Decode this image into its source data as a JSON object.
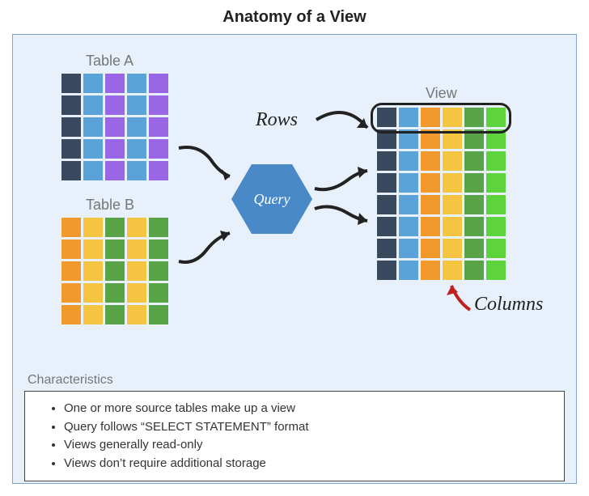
{
  "title": "Anatomy of a View",
  "labels": {
    "table_a": "Table A",
    "table_b": "Table B",
    "view": "View",
    "query": "Query",
    "rows": "Rows",
    "columns": "Columns",
    "characteristics": "Characteristics"
  },
  "characteristics": {
    "items": [
      "One or more source tables make up a view",
      "Query follows “SELECT STATEMENT” format",
      "Views generally read-only",
      "Views don’t require additional storage"
    ]
  },
  "colors": {
    "darkblue": "#3a4a5e",
    "blue": "#5aa3d9",
    "purple": "#9966e6",
    "orange": "#f2992e",
    "yellow": "#f5c542",
    "green": "#57a346",
    "brightgreen": "#5ed43c"
  },
  "tables": {
    "a": {
      "rows": 5,
      "cols": 5,
      "pattern": [
        "darkblue",
        "blue",
        "purple",
        "blue",
        "purple"
      ]
    },
    "b": {
      "rows": 5,
      "cols": 5,
      "pattern": [
        "orange",
        "yellow",
        "green",
        "yellow",
        "green"
      ]
    },
    "view": {
      "rows": 8,
      "cols": 6,
      "pattern": [
        "darkblue",
        "blue",
        "orange",
        "yellow",
        "green",
        "brightgreen"
      ]
    }
  }
}
